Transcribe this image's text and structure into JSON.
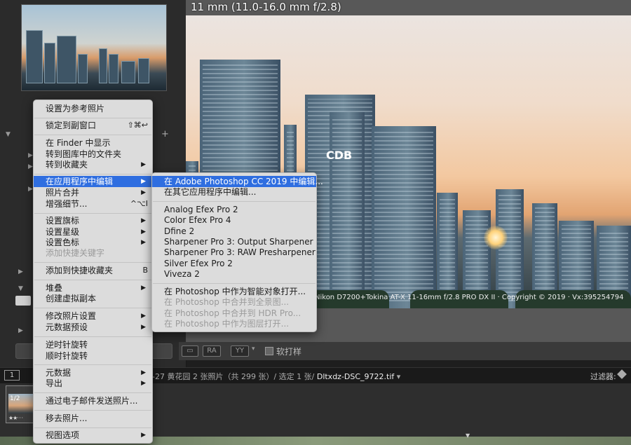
{
  "info_overlay": "11 mm (11.0-16.0 mm f/2.8)",
  "exif_overlay": "Nikon D7200+Tokina AT-X 11-16mm f/2.8 PRO DX II · Copyright © 2019 · Vx:395254794",
  "building_sign": "CDB",
  "toolbar": {
    "view_btn_2": "RA",
    "view_btn_3": "YY",
    "softproof_label": "软打样"
  },
  "filmbar": {
    "screen_num": "1",
    "path_prefix": "-27 黄花园  2 张照片（共 299 张）/ 选定 1 张/ ",
    "file_name": "Dltxdz-DSC_9722.tif",
    "file_caret": "▾",
    "filter_label": "过滤器:"
  },
  "thumb": {
    "badge": "1/2",
    "stars": "★★·  ·  ·"
  },
  "context_menu": {
    "items": [
      {
        "label": "设置为参考照片"
      },
      {
        "label": "锁定到副窗口",
        "shortcut": "⇧⌘↩"
      },
      {
        "label": "在 Finder 中显示"
      },
      {
        "label": "转到图库中的文件夹"
      },
      {
        "label": "转到收藏夹",
        "arrow": "▶"
      },
      {
        "label": "在应用程序中编辑",
        "arrow": "▶"
      },
      {
        "label": "照片合并",
        "arrow": "▶"
      },
      {
        "label": "增强细节...",
        "shortcut": "^⌥I"
      },
      {
        "label": "设置旗标",
        "arrow": "▶"
      },
      {
        "label": "设置星级",
        "arrow": "▶"
      },
      {
        "label": "设置色标",
        "arrow": "▶"
      },
      {
        "label": "添加快捷关键字"
      },
      {
        "label": "添加到快捷收藏夹",
        "shortcut": "B"
      },
      {
        "label": "堆叠",
        "arrow": "▶"
      },
      {
        "label": "创建虚拟副本"
      },
      {
        "label": "修改照片设置",
        "arrow": "▶"
      },
      {
        "label": "元数据预设",
        "arrow": "▶"
      },
      {
        "label": "逆时针旋转"
      },
      {
        "label": "顺时针旋转"
      },
      {
        "label": "元数据",
        "arrow": "▶"
      },
      {
        "label": "导出",
        "arrow": "▶"
      },
      {
        "label": "通过电子邮件发送照片..."
      },
      {
        "label": "移去照片..."
      },
      {
        "label": "视图选项",
        "arrow": "▶"
      }
    ]
  },
  "submenu": {
    "items": [
      {
        "label": "在 Adobe Photoshop CC 2019 中编辑..."
      },
      {
        "label": "在其它应用程序中编辑..."
      },
      {
        "label": "Analog Efex Pro 2"
      },
      {
        "label": "Color Efex Pro 4"
      },
      {
        "label": "Dfine 2"
      },
      {
        "label": "Sharpener Pro 3: Output Sharpener"
      },
      {
        "label": "Sharpener Pro 3: RAW Presharpener"
      },
      {
        "label": "Silver Efex Pro 2"
      },
      {
        "label": "Viveza 2"
      },
      {
        "label": "在 Photoshop 中作为智能对象打开..."
      },
      {
        "label": "在 Photoshop 中合并到全景图..."
      },
      {
        "label": "在 Photoshop 中合并到 HDR Pro..."
      },
      {
        "label": "在 Photoshop 中作为图层打开..."
      }
    ]
  },
  "colors": {
    "menu_highlight": "#2f6ee0",
    "menu_bg": "#dcdcdc"
  }
}
